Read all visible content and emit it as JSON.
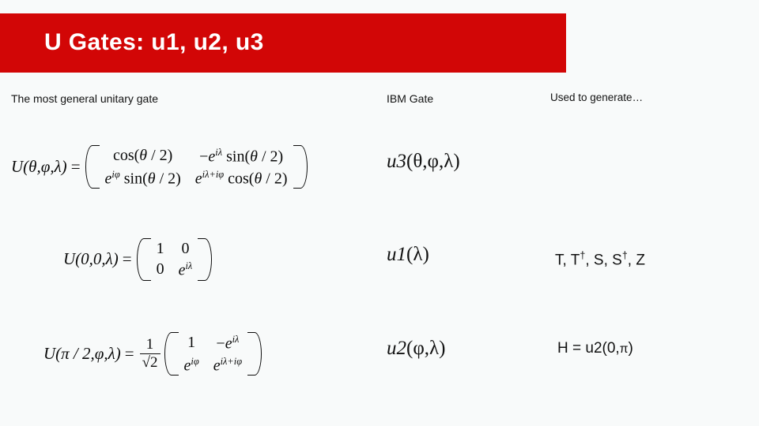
{
  "slide": {
    "title": "U Gates: u1, u2, u3",
    "banner_color": "#d20606",
    "background_color": "#f8fafa"
  },
  "columns": {
    "left_heading": "The most general unitary gate",
    "middle_heading": "IBM Gate",
    "right_heading": "Used to generate…"
  },
  "rows": [
    {
      "equation": {
        "lhs": "U(θ,φ,λ)",
        "eq": "=",
        "matrix": [
          [
            "cos(θ / 2)",
            "−e^{iλ} sin(θ / 2)"
          ],
          [
            "e^{iφ} sin(θ / 2)",
            "e^{iλ+iφ} cos(θ / 2)"
          ]
        ],
        "cells": {
          "c00_base": "cos(",
          "c00_var": "θ",
          "c00_tail": " / 2)",
          "c01_sign": "−",
          "c01_e": "e",
          "c01_exp": "iλ",
          "c01_fn": " sin(",
          "c01_var": "θ",
          "c01_tail": " / 2)",
          "c10_e": "e",
          "c10_exp": "iφ",
          "c10_fn": " sin(",
          "c10_var": "θ",
          "c10_tail": " / 2)",
          "c11_e": "e",
          "c11_exp": "iλ+iφ",
          "c11_fn": " cos(",
          "c11_var": "θ",
          "c11_tail": " / 2)"
        }
      },
      "gate": {
        "name": "u3",
        "args": "(θ,φ,λ)"
      },
      "generates": ""
    },
    {
      "equation": {
        "lhs": "U(0,0,λ)",
        "eq": "=",
        "matrix": [
          [
            "1",
            "0"
          ],
          [
            "0",
            "e^{iλ}"
          ]
        ],
        "cells": {
          "c00": "1",
          "c01": "0",
          "c10": "0",
          "c11_e": "e",
          "c11_exp": "iλ"
        }
      },
      "gate": {
        "name": "u1",
        "args": "(λ)"
      },
      "generates": "T, T†, S, S†, Z",
      "generates_parts": {
        "t": "T",
        "sep1": ", ",
        "tdag_base": "T",
        "tdag_sup": "†",
        "sep2": ", ",
        "s": "S",
        "sep3": ", ",
        "sdag_base": "S",
        "sdag_sup": "†",
        "sep4": ", ",
        "z": "Z"
      }
    },
    {
      "equation": {
        "lhs": "U(π / 2,φ,λ)",
        "eq": "=",
        "prefactor_num": "1",
        "prefactor_den": "√2",
        "matrix": [
          [
            "1",
            "−e^{iλ}"
          ],
          [
            "e^{iφ}",
            "e^{iλ+iφ}"
          ]
        ],
        "cells": {
          "c00": "1",
          "c01_sign": "−",
          "c01_e": "e",
          "c01_exp": "iλ",
          "c10_e": "e",
          "c10_exp": "iφ",
          "c11_e": "e",
          "c11_exp": "iλ+iφ"
        }
      },
      "gate": {
        "name": "u2",
        "args": "(φ,λ)"
      },
      "generates": "H = u2(0,π)",
      "generates_parts": {
        "prefix": "H = u2(0,",
        "pi": "π",
        "suffix": ")"
      }
    }
  ]
}
